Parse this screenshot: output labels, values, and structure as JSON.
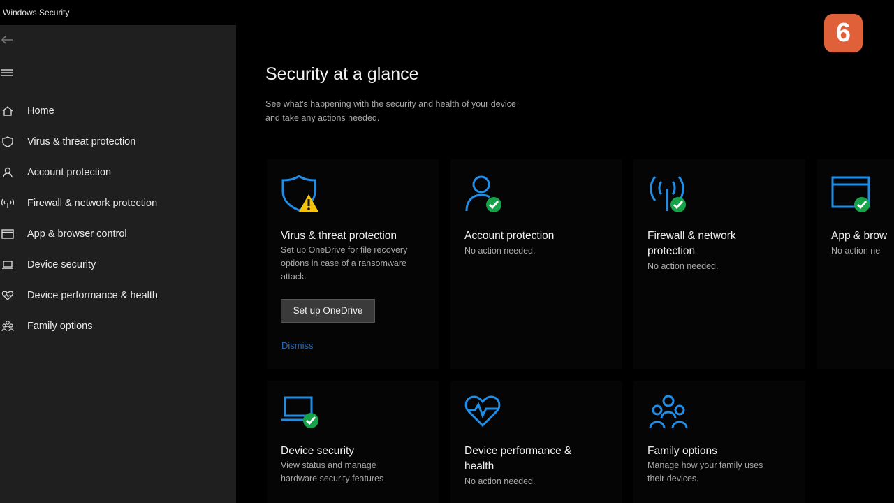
{
  "window": {
    "title": "Windows Security"
  },
  "sidebar": {
    "items": [
      {
        "label": "Home",
        "icon": "home-icon"
      },
      {
        "label": "Virus & threat protection",
        "icon": "shield-icon"
      },
      {
        "label": "Account protection",
        "icon": "person-icon"
      },
      {
        "label": "Firewall & network protection",
        "icon": "antenna-icon"
      },
      {
        "label": "App & browser control",
        "icon": "browser-window-icon"
      },
      {
        "label": "Device security",
        "icon": "laptop-icon"
      },
      {
        "label": "Device performance & health",
        "icon": "heart-icon"
      },
      {
        "label": "Family options",
        "icon": "family-icon"
      }
    ]
  },
  "main": {
    "title": "Security at a glance",
    "description_line1": "See what's happening with the security and health of your device",
    "description_line2": "and take any actions needed.",
    "tiles": [
      {
        "title": "Virus & threat protection",
        "desc_line1": "Set up OneDrive for file recovery",
        "desc_line2": "options in case of a ransomware",
        "desc_line3": "attack.",
        "button": "Set up OneDrive",
        "link": "Dismiss",
        "status": "warning"
      },
      {
        "title": "Account protection",
        "desc": "No action needed.",
        "status": "ok"
      },
      {
        "title_line1": "Firewall & network",
        "title_line2": "protection",
        "desc": "No action needed.",
        "status": "ok"
      },
      {
        "title": "App & brow",
        "desc": "No action ne",
        "status": "ok"
      },
      {
        "title": "Device security",
        "desc_line1": "View status and manage",
        "desc_line2": "hardware security features",
        "status": "ok"
      },
      {
        "title_line1": "Device performance &",
        "title_line2": "health",
        "desc": "No action needed."
      },
      {
        "title": "Family options",
        "desc_line1": "Manage how your family uses",
        "desc_line2": "their devices."
      }
    ]
  },
  "logo": {
    "text": "6"
  },
  "colors": {
    "accent_blue": "#1e8ee8",
    "ok_green": "#16a34a",
    "warning_yellow": "#f4c20d",
    "sidebar_bg": "#1f1f1f",
    "main_bg": "#000000",
    "logo_bg": "#e0603a"
  }
}
